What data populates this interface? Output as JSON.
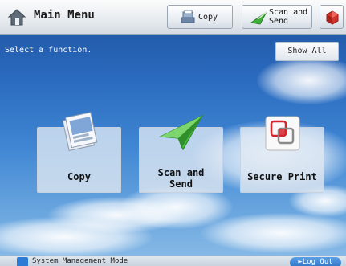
{
  "header": {
    "title": "Main Menu",
    "copy_label": "Copy",
    "scan_label_line1": "Scan and",
    "scan_label_line2": "Send"
  },
  "message": "Select a function.",
  "show_all_label": "Show All",
  "tiles": [
    {
      "label": "Copy"
    },
    {
      "label_line1": "Scan and",
      "label_line2": "Send"
    },
    {
      "label": "Secure Print"
    }
  ],
  "footer": {
    "mode_text": "System Management Mode",
    "logout_label": "Log Out"
  },
  "colors": {
    "sky": "#2b6bbf",
    "tile_bg": "#dbe5f0",
    "accent_blue": "#2e7bd6",
    "scan_icon_green": "#3fae3a",
    "secure_icon_red": "#d4252c"
  },
  "icons": {
    "home": "home-icon",
    "copy": "copy-icon",
    "scan_send": "scan-send-icon",
    "app": "app-icon",
    "secure_print": "secure-print-icon",
    "system": "system-icon"
  }
}
